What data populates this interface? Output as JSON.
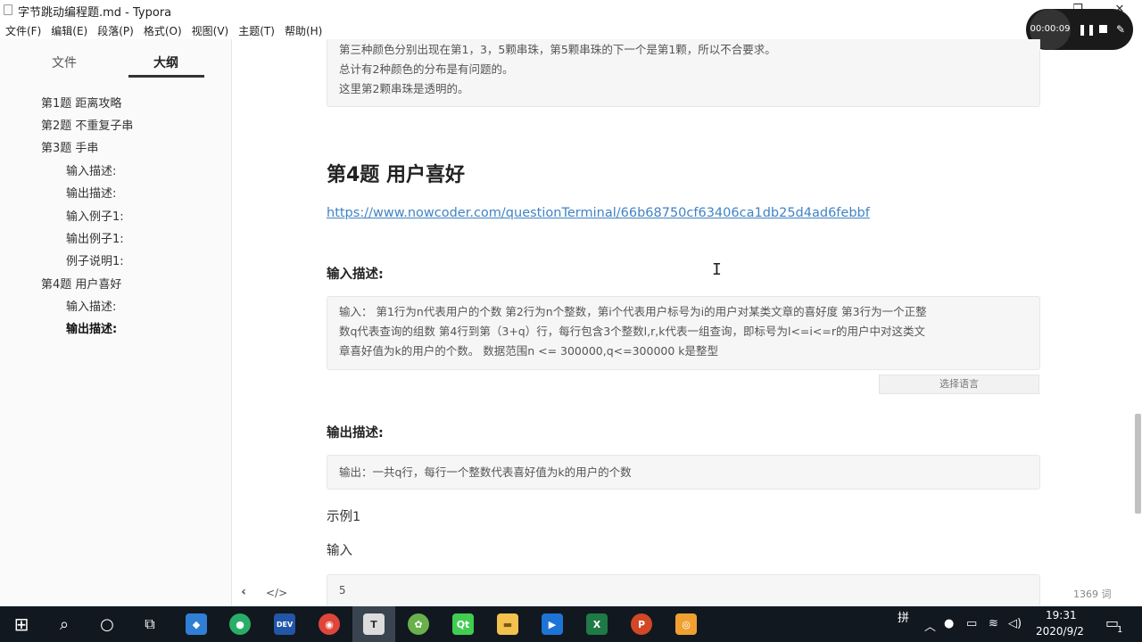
{
  "window": {
    "title": "字节跳动编程题.md - Typora",
    "minimize": "—",
    "restore": "❐",
    "close": "✕"
  },
  "menu": [
    "文件(F)",
    "编辑(E)",
    "段落(P)",
    "格式(O)",
    "视图(V)",
    "主题(T)",
    "帮助(H)"
  ],
  "recorder": {
    "time": "00:00:09"
  },
  "sidebar": {
    "tabs": [
      {
        "label": "文件",
        "active": false
      },
      {
        "label": "大纲",
        "active": true
      }
    ],
    "outline": [
      {
        "label": "第1题 距离攻略",
        "level": 1,
        "bold": false
      },
      {
        "label": "第2题 不重复子串",
        "level": 1,
        "bold": false
      },
      {
        "label": "第3题 手串",
        "level": 1,
        "bold": false
      },
      {
        "label": "输入描述:",
        "level": 2,
        "bold": false
      },
      {
        "label": "输出描述:",
        "level": 2,
        "bold": false
      },
      {
        "label": "输入例子1:",
        "level": 2,
        "bold": false
      },
      {
        "label": "输出例子1:",
        "level": 2,
        "bold": false
      },
      {
        "label": "例子说明1:",
        "level": 2,
        "bold": false
      },
      {
        "label": "第4题 用户喜好",
        "level": 1,
        "bold": false
      },
      {
        "label": "输入描述:",
        "level": 2,
        "bold": false
      },
      {
        "label": "输出描述:",
        "level": 2,
        "bold": true
      }
    ],
    "footer_left": "‹",
    "footer_code": "</>"
  },
  "editor": {
    "top_block_lines": [
      "第三种颜色分别出现在第1，3，5颗串珠，第5颗串珠的下一个是第1颗，所以不合要求。",
      "总计有2种颜色的分布是有问题的。",
      "这里第2颗串珠是透明的。"
    ],
    "heading": "第4题 用户喜好",
    "link": "https://www.nowcoder.com/questionTerminal/66b68750cf63406ca1db25d4ad6febbf",
    "input_heading": "输入描述:",
    "input_lines": [
      "输入： 第1行为n代表用户的个数 第2行为n个整数，第i个代表用户标号为i的用户对某类文章的喜好度 第3行为一个正整",
      "数q代表查询的组数  第4行到第（3+q）行，每行包含3个整数l,r,k代表一组查询，即标号为l<=i<=r的用户中对这类文",
      "章喜好值为k的用户的个数。 数据范围n <= 300000,q<=300000 k是整型"
    ],
    "lang_select": "选择语言",
    "output_heading": "输出描述:",
    "output_line": "输出：一共q行，每行一个整数代表喜好值为k的用户的个数",
    "example_label": "示例1",
    "input_label": "输入",
    "example_first_line": "5",
    "word_count": "1369 词"
  },
  "taskbar": {
    "apps": [
      {
        "name": "windows-start",
        "glyph": "⊞",
        "color": "#111820"
      },
      {
        "name": "search",
        "glyph": "⌕",
        "color": "#111820"
      },
      {
        "name": "cortana",
        "glyph": "○",
        "color": "#111820"
      },
      {
        "name": "task-view",
        "glyph": "⧉",
        "color": "#111820"
      },
      {
        "name": "app-blue",
        "glyph": "◆",
        "color": "#2f7fd6"
      },
      {
        "name": "wechat",
        "glyph": "●",
        "color": "#2aae67"
      },
      {
        "name": "dev-cpp",
        "glyph": "DEV",
        "color": "#2256a8"
      },
      {
        "name": "chrome",
        "glyph": "◉",
        "color": "#e0453a"
      },
      {
        "name": "typora",
        "glyph": "T",
        "color": "#dcdcdc"
      },
      {
        "name": "leaf-app",
        "glyph": "✿",
        "color": "#6ab04c"
      },
      {
        "name": "qt",
        "glyph": "Qt",
        "color": "#41cd52"
      },
      {
        "name": "file-explorer",
        "glyph": "▬",
        "color": "#f2c14e"
      },
      {
        "name": "video-app",
        "glyph": "▶",
        "color": "#1e74d6"
      },
      {
        "name": "excel",
        "glyph": "X",
        "color": "#1f7a45"
      },
      {
        "name": "powerpoint",
        "glyph": "P",
        "color": "#d24726"
      },
      {
        "name": "recorder-app",
        "glyph": "◎",
        "color": "#f0a030"
      }
    ],
    "ime": "拼",
    "time": "19:31",
    "date": "2020/9/2",
    "notification_count": "1"
  }
}
